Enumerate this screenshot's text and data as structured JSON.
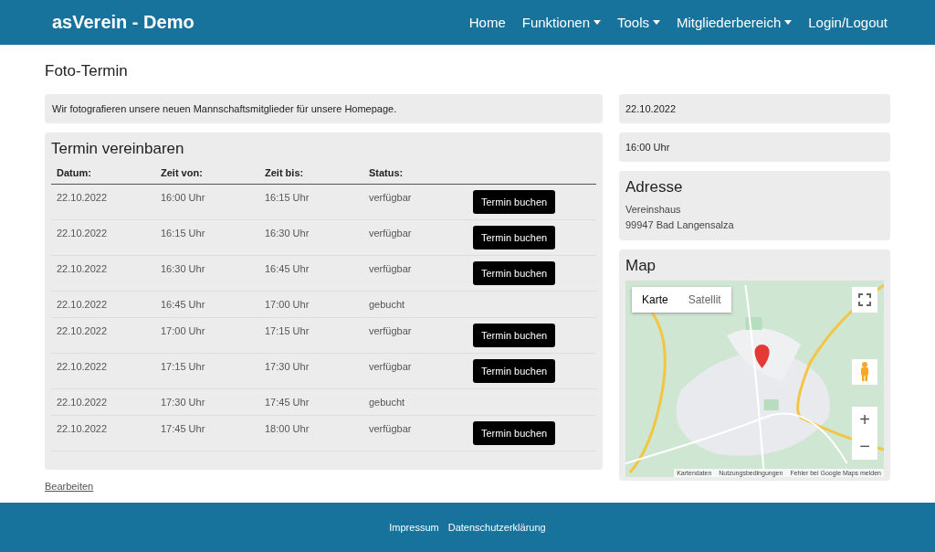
{
  "navbar": {
    "brand": "asVerein - Demo",
    "items": [
      {
        "label": "Home",
        "dropdown": false
      },
      {
        "label": "Funktionen",
        "dropdown": true
      },
      {
        "label": "Tools",
        "dropdown": true
      },
      {
        "label": "Mitgliederbereich",
        "dropdown": true
      },
      {
        "label": "Login/Logout",
        "dropdown": false
      }
    ]
  },
  "page_title": "Foto-Termin",
  "description": "Wir fotografieren unsere neuen Mannschaftsmitglieder für unsere Homepage.",
  "booking": {
    "title": "Termin vereinbaren",
    "columns": [
      "Datum:",
      "Zeit von:",
      "Zeit bis:",
      "Status:"
    ],
    "rows": [
      {
        "date": "22.10.2022",
        "from": "16:00 Uhr",
        "to": "16:15 Uhr",
        "status": "verfügbar",
        "button": "Termin buchen"
      },
      {
        "date": "22.10.2022",
        "from": "16:15 Uhr",
        "to": "16:30 Uhr",
        "status": "verfügbar",
        "button": "Termin buchen"
      },
      {
        "date": "22.10.2022",
        "from": "16:30 Uhr",
        "to": "16:45 Uhr",
        "status": "verfügbar",
        "button": "Termin buchen"
      },
      {
        "date": "22.10.2022",
        "from": "16:45 Uhr",
        "to": "17:00 Uhr",
        "status": "gebucht"
      },
      {
        "date": "22.10.2022",
        "from": "17:00 Uhr",
        "to": "17:15 Uhr",
        "status": "verfügbar",
        "button": "Termin buchen"
      },
      {
        "date": "22.10.2022",
        "from": "17:15 Uhr",
        "to": "17:30 Uhr",
        "status": "verfügbar",
        "button": "Termin buchen"
      },
      {
        "date": "22.10.2022",
        "from": "17:30 Uhr",
        "to": "17:45 Uhr",
        "status": "gebucht"
      },
      {
        "date": "22.10.2022",
        "from": "17:45 Uhr",
        "to": "18:00 Uhr",
        "status": "verfügbar",
        "button": "Termin buchen"
      }
    ]
  },
  "edit_link": "Bearbeiten",
  "sidebar": {
    "date": "22.10.2022",
    "time": "16:00 Uhr",
    "address": {
      "title": "Adresse",
      "lines": [
        "Vereinshaus",
        "99947 Bad Langensalza"
      ]
    },
    "map": {
      "title": "Map",
      "kind": "picture",
      "map_types": [
        {
          "label": "Karte",
          "selected": true
        },
        {
          "label": "Satellit",
          "selected": false
        }
      ],
      "zoom_in": "+",
      "zoom_out": "−",
      "attribution": [
        "Kartendaten",
        "Nutzungsbedingungen",
        "Fehler bei Google Maps melden"
      ]
    }
  },
  "footer": {
    "links": [
      "Impressum",
      "Datenschutzerklärung"
    ]
  }
}
